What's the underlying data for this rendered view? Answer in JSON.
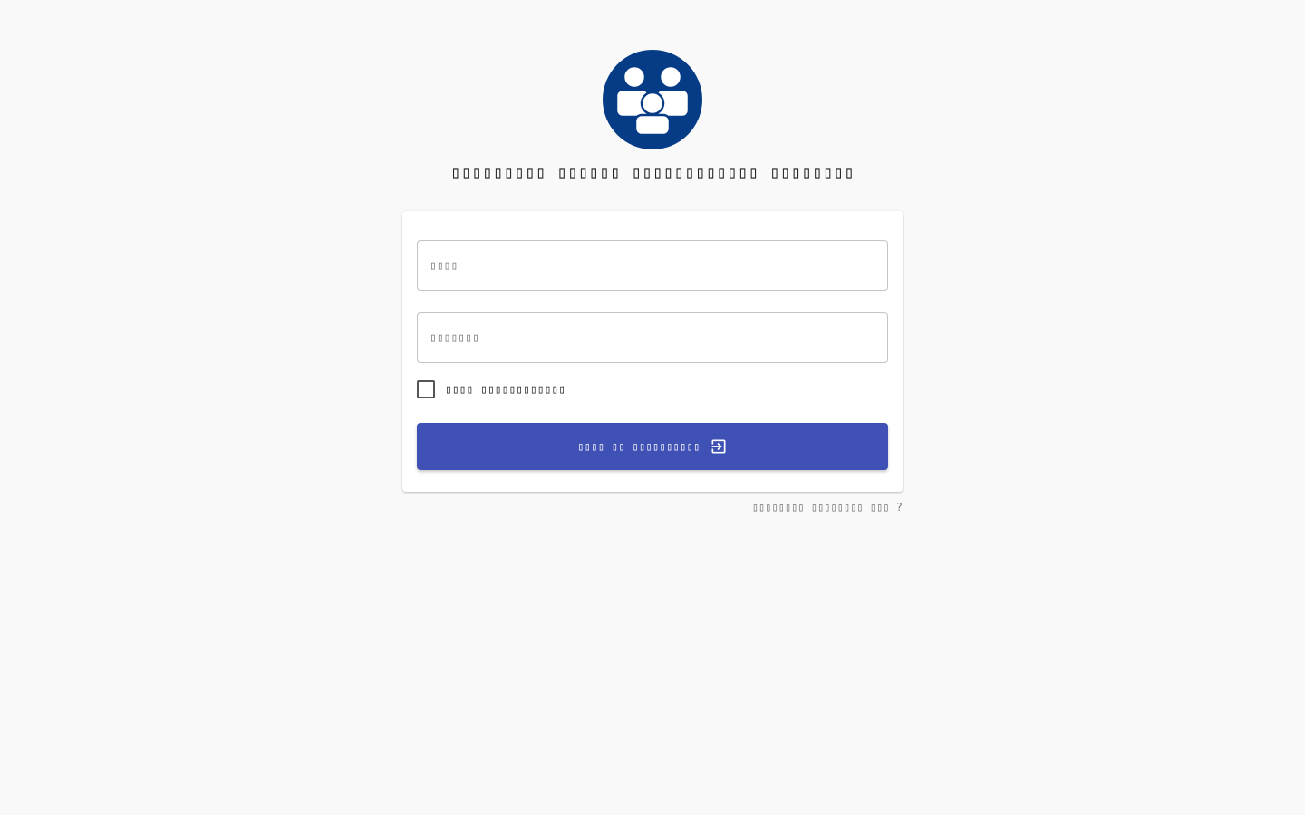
{
  "app": {
    "title": "▯▯▯▯▯▯▯▯▯ ▯▯▯▯▯▯ ▯▯▯▯▯▯▯▯▯▯▯▯ ▯▯▯▯▯▯▯▯"
  },
  "login_form": {
    "username_placeholder": "▯▯▯▯",
    "username_value": "",
    "password_placeholder": "▯▯▯▯▯▯▯",
    "password_value": "",
    "remember_label": "▯▯▯▯ ▯▯▯▯▯▯▯▯▯▯▯▯",
    "remember_checked": false,
    "submit_label": "▯▯▯▯ ▯▯ ▯▯▯▯▯▯▯▯▯▯",
    "submit_icon": "login-icon"
  },
  "forgot_password": {
    "label": "▯▯▯▯▯▯▯▯ ▯▯▯▯▯▯▯▯ ▯▯▯ ?"
  },
  "logo": {
    "icon": "users-group-icon"
  },
  "colors": {
    "background": "#f9f9f9",
    "logo_blue": "#063b85",
    "primary_button": "#3f51b5",
    "card": "#ffffff"
  }
}
